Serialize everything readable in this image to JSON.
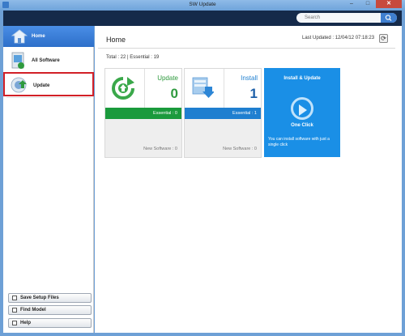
{
  "window": {
    "title": "SW Update",
    "minimize_glyph": "–",
    "maximize_glyph": "□",
    "close_glyph": "✕"
  },
  "search": {
    "placeholder": "Search"
  },
  "sidebar": {
    "home_label": "Home",
    "items": [
      {
        "label": "All Software",
        "icon": "all-software-icon"
      },
      {
        "label": "Update",
        "icon": "update-icon",
        "selected": true
      }
    ],
    "buttons": [
      {
        "label": "Save Setup Files"
      },
      {
        "label": "Find Model"
      },
      {
        "label": "Help"
      }
    ]
  },
  "main": {
    "title": "Home",
    "last_updated": "Last Updated : 12/04/12 07:18:23",
    "refresh_glyph": "⟳",
    "totals": "Total : 22 | Essential : 19",
    "cards": [
      {
        "title": "Update",
        "count": "0",
        "essential": "Essential : 0",
        "new_software": "New Software : 0",
        "accent": "#1a9a3c",
        "title_color": "#2f9a3e",
        "count_color": "#2f9a3e"
      },
      {
        "title": "Install",
        "count": "1",
        "essential": "Essential : 1",
        "new_software": "New Software : 0",
        "accent": "#1f7fd0",
        "title_color": "#1f7fd0",
        "count_color": "#1d5fa8"
      }
    ],
    "promo": {
      "title": "Install & Update",
      "one_click": "One Click",
      "description": "You can install software with just a single click",
      "color": "#1a8fe6"
    }
  },
  "colors": {
    "window_frame": "#6ea0d6",
    "topbar": "#152a4a",
    "selection_outline": "#d22027",
    "home_bar": "#2d6fc9"
  }
}
